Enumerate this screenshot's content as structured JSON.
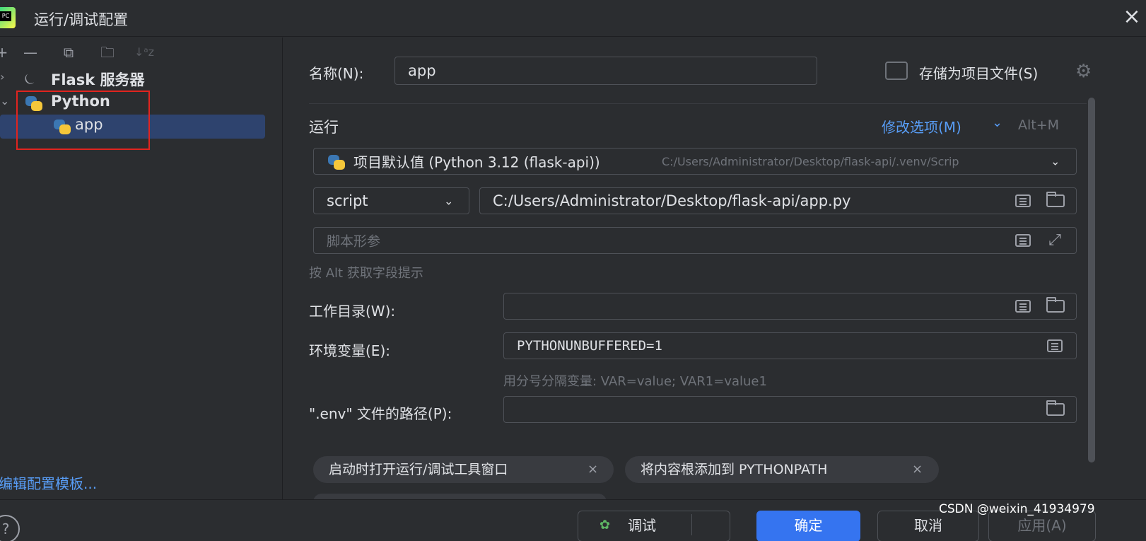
{
  "window": {
    "title": "运行/调试配置",
    "logo_text": "PC"
  },
  "toolbar": {
    "add": "+",
    "remove": "—",
    "copy": "⧉",
    "new_folder": "🗀",
    "sort": "↓ᵃz"
  },
  "tree": {
    "flask": "Flask 服务器",
    "python": "Python",
    "app": "app"
  },
  "edit_templates": "编辑配置模板...",
  "help": "?",
  "form": {
    "name_label": "名称(N):",
    "name_value": "app",
    "store_label": "存储为项目文件(S)",
    "run_section": "运行",
    "modify_options": "修改选项(M)",
    "modify_shortcut": "Alt+M",
    "interpreter_name": "项目默认值 (Python 3.12 (flask-api))",
    "interpreter_path": "C:/Users/Administrator/Desktop/flask-api/.venv/Scrip",
    "script_type": "script",
    "script_path": "C:/Users/Administrator/Desktop/flask-api/app.py",
    "script_params_placeholder": "脚本形参",
    "alt_hint": "按 Alt 获取字段提示",
    "workdir_label": "工作目录(W):",
    "workdir_value": "",
    "env_label": "环境变量(E):",
    "env_value": "PYTHONUNBUFFERED=1",
    "env_hint": "用分号分隔变量: VAR=value; VAR1=value1",
    "dotenv_label": "\".env\" 文件的路径(P):",
    "dotenv_value": "",
    "chip1": "启动时打开运行/调试工具窗口",
    "chip2": "将内容根添加到 PYTHONPATH"
  },
  "buttons": {
    "debug": "调试",
    "ok": "确定",
    "cancel": "取消",
    "apply": "应用(A)"
  },
  "watermark": "CSDN @weixin_41934979",
  "colors": {
    "accent": "#3574f0",
    "highlight_box": "#e1241f",
    "selection": "#2e436e",
    "link": "#589df6"
  }
}
